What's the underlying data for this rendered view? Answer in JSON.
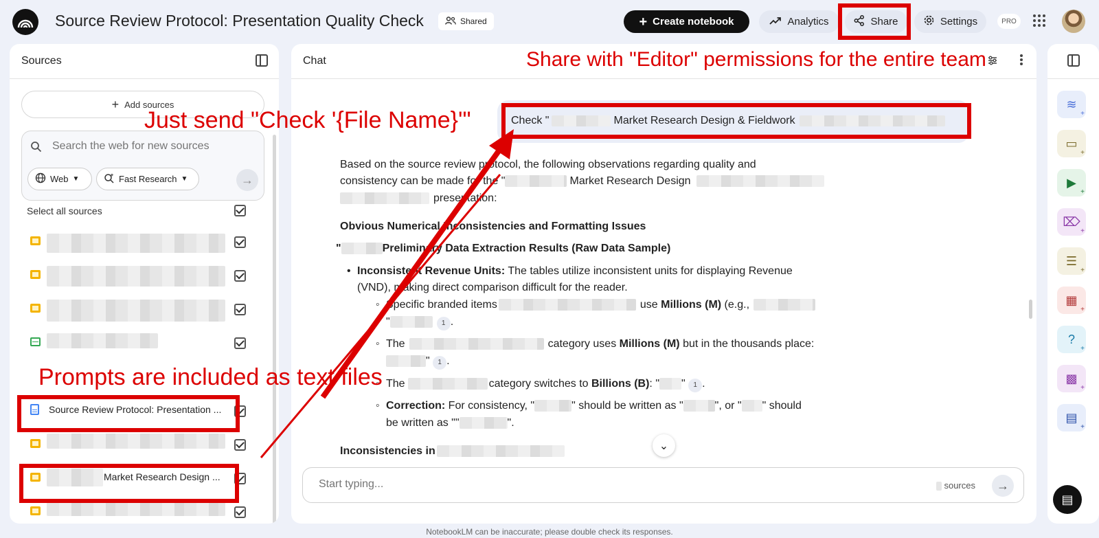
{
  "header": {
    "title": "Source Review Protocol: Presentation Quality Check",
    "shared_label": "Shared",
    "create_label": "Create notebook",
    "analytics_label": "Analytics",
    "share_label": "Share",
    "settings_label": "Settings",
    "pro_label": "PRO"
  },
  "sources": {
    "title": "Sources",
    "add_label": "Add sources",
    "search_placeholder": "Search the web for new sources",
    "web_chip": "Web",
    "research_chip": "Fast Research",
    "select_all": "Select all sources",
    "items": [
      {
        "type": "slides",
        "label": ""
      },
      {
        "type": "slides",
        "label": ""
      },
      {
        "type": "slides",
        "label": ""
      },
      {
        "type": "sheet",
        "label": ""
      },
      {
        "type": "doc",
        "label": "Source Review Protocol: Presentation ..."
      },
      {
        "type": "slides",
        "label": ""
      },
      {
        "type": "slides",
        "label": "Market Research Design ..."
      },
      {
        "type": "slides",
        "label": ""
      }
    ]
  },
  "chat": {
    "title": "Chat",
    "user_message_prefix": "Check \"",
    "user_message_mid": "Market Research Design & Fieldwork",
    "intro_line1": "Based on the source review protocol, the following observations regarding quality and",
    "intro_line2a": "consistency can be made for the \"",
    "intro_line2b": "Market Research Design",
    "intro_line3": "presentation:",
    "heading1": "Obvious Numerical Inconsistencies and Formatting Issues",
    "subheading_quote": "\"",
    "subheading": "Preliminary Data Extraction Results (Raw Data Sample)",
    "bullet_bold": "Inconsistent Revenue Units:",
    "bullet_text1": " The tables utilize inconsistent units for displaying Revenue",
    "bullet_text2": "(VND), making direct comparison difficult for the reader.",
    "sub1_a": "Specific branded items",
    "sub1_b": "use",
    "sub1_bold": "Millions (M)",
    "sub1_c": "(e.g.,",
    "sub1_quote": "\"",
    "sub2_a": "The",
    "sub2_b": "category uses",
    "sub2_bold": "Millions (M)",
    "sub2_c": "but in the thousands place:",
    "sub2_quote": "\"",
    "sub3_a": "The",
    "sub3_b": "category switches to",
    "sub3_bold": "Billions (B)",
    "sub3_c": ": \"",
    "sub3_d": "\"",
    "corr_bold": "Correction:",
    "corr_text1a": " For consistency, \"",
    "corr_text1b": "\" should be written as \"",
    "corr_text1c": "\", or \"",
    "corr_text1d": "\" should",
    "corr_text2a": "be written as \"\"",
    "corr_text2b": "\".",
    "heading2": "Inconsistencies in",
    "cite": "1",
    "input_placeholder": "Start typing...",
    "sources_count": "sources"
  },
  "footer": "NotebookLM can be inaccurate; please double check its responses.",
  "annotations": {
    "share_note": "Share with \"Editor\" permissions for the entire team",
    "send_note": "Just send \"Check '{File Name}'\"",
    "prompts_note": "Prompts are included as text files",
    "color": "#dc0000"
  },
  "studio_icons": [
    {
      "name": "audio-overview-icon",
      "color": "#4a6fd8",
      "bg": "#e8eefb"
    },
    {
      "name": "video-overview-icon",
      "color": "#7a6a2a",
      "bg": "#f4f1e2"
    },
    {
      "name": "slides-icon",
      "color": "#1e7a3a",
      "bg": "#e5f4e8"
    },
    {
      "name": "mind-map-icon",
      "color": "#8b3aa8",
      "bg": "#f3e6f7"
    },
    {
      "name": "reports-icon",
      "color": "#7a6a2a",
      "bg": "#f4f1e2"
    },
    {
      "name": "flashcards-icon",
      "color": "#b23a3a",
      "bg": "#fbe8e6"
    },
    {
      "name": "quiz-icon",
      "color": "#1a7ba8",
      "bg": "#e3f3f9"
    },
    {
      "name": "infographic-icon",
      "color": "#8b3aa8",
      "bg": "#f3e6f7"
    },
    {
      "name": "data-table-icon",
      "color": "#2a4fa8",
      "bg": "#e8eefb"
    }
  ]
}
